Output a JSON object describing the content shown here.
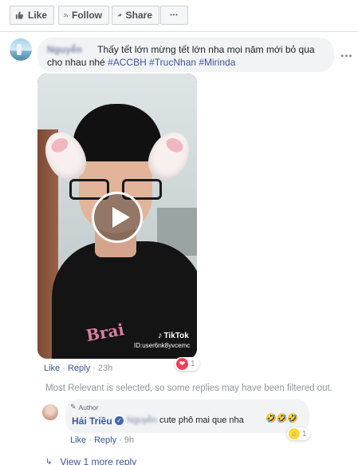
{
  "actions": {
    "like": "Like",
    "follow": "Follow",
    "share": "Share",
    "more": "•••"
  },
  "comment": {
    "author": "Nguyễn",
    "text": "Thấy tết lớn mừng tết lớn nha mọi năm mới bỏ qua cho nhau nhé",
    "hashtags": "#ACCBH #TrucNhan #Mirinda",
    "menu": "•••",
    "video": {
      "watermark": "TikTok",
      "user_id": "ID:user6nk8yvcemc",
      "shirt_print": "Brai"
    },
    "like_link": "Like",
    "reply_link": "Reply",
    "time": "23h",
    "reaction_count": "1",
    "reaction_icon": "heart-icon",
    "reaction_color": "#f33e58"
  },
  "filter_notice": "Most Relevant is selected, so some replies may have been filtered out.",
  "reply": {
    "badge": "Author",
    "author": "Hải Triều",
    "mention": "Nguyễn",
    "text": "cute phô mai que nha",
    "emoji": "🤣🤣🤣",
    "like_link": "Like",
    "reply_link": "Reply",
    "time": "9h",
    "reaction_count": "1",
    "reaction_icon": "haha-icon"
  },
  "view_more": "View 1 more reply",
  "colors": {
    "link": "#385898",
    "meta": "#90949c",
    "bubble": "#f2f3f5"
  }
}
